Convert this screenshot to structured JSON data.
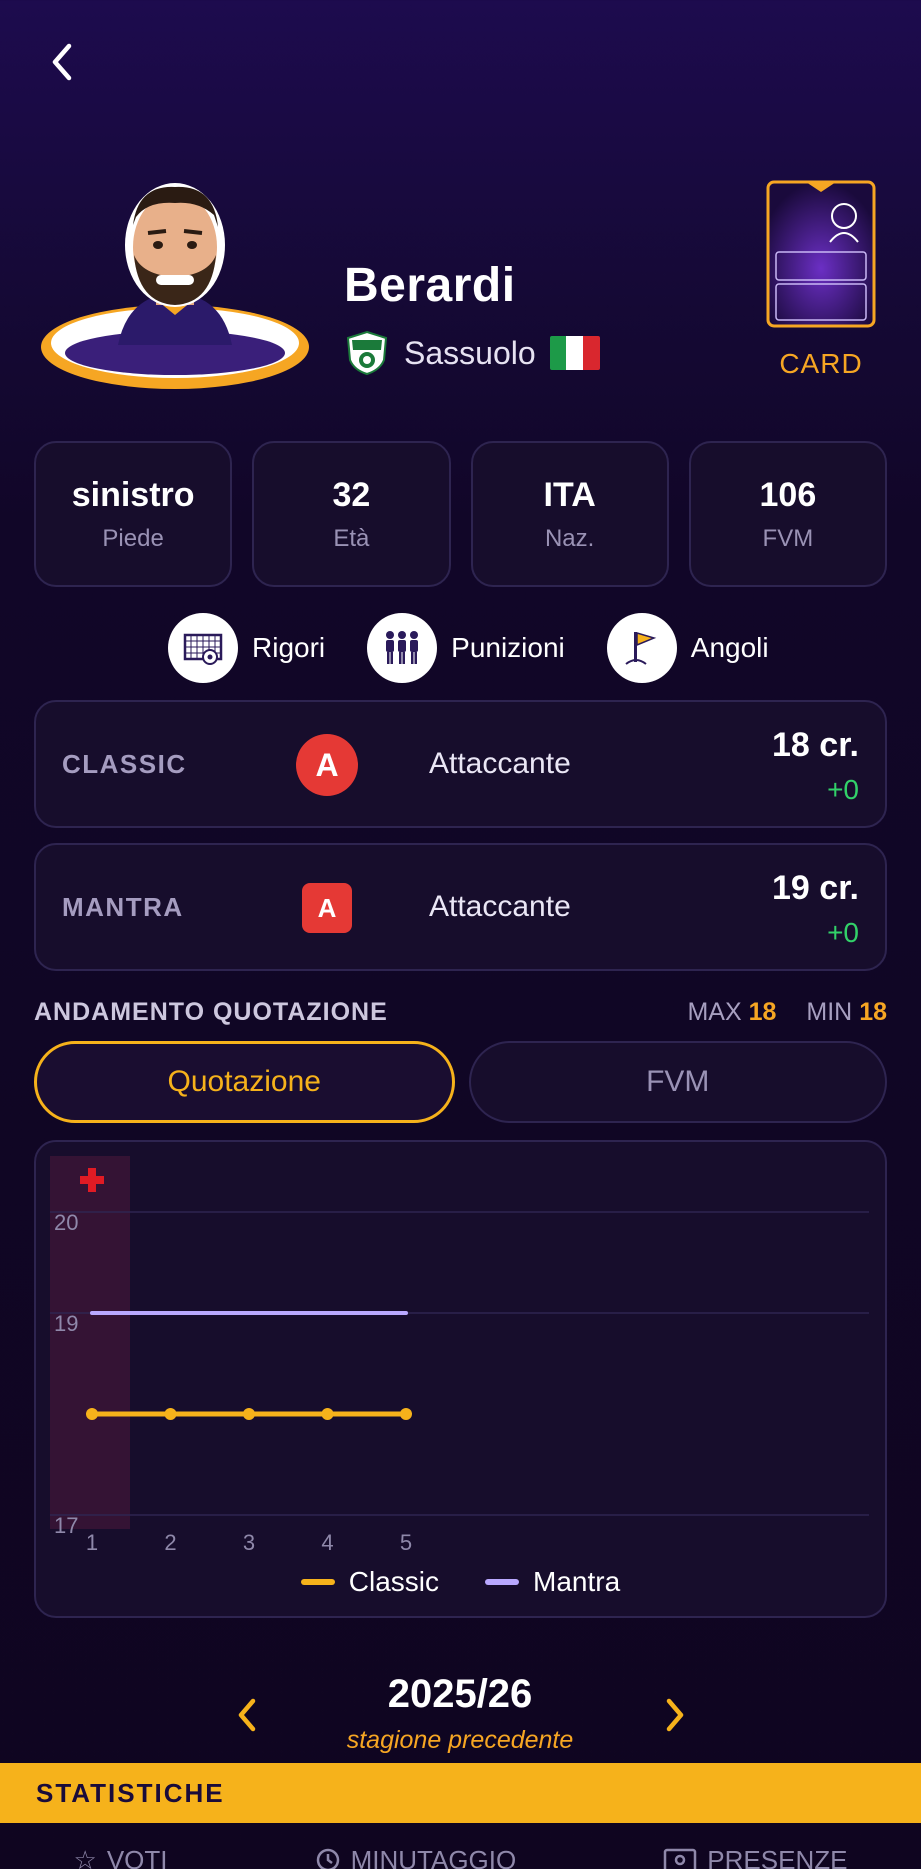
{
  "player": {
    "name": "Berardi",
    "team": "Sassuolo",
    "card_label": "CARD"
  },
  "tiles": [
    {
      "value": "sinistro",
      "label": "Piede"
    },
    {
      "value": "32",
      "label": "Età"
    },
    {
      "value": "ITA",
      "label": "Naz."
    },
    {
      "value": "106",
      "label": "FVM"
    }
  ],
  "skills": [
    {
      "label": "Rigori",
      "icon": "penalty-goal-icon"
    },
    {
      "label": "Punizioni",
      "icon": "wall-players-icon"
    },
    {
      "label": "Angoli",
      "icon": "corner-flag-icon"
    }
  ],
  "roles": [
    {
      "mode": "CLASSIC",
      "badge": "A",
      "role": "Attaccante",
      "price": "18 cr.",
      "delta": "+0"
    },
    {
      "mode": "MANTRA",
      "badge": "A",
      "role": "Attaccante",
      "price": "19 cr.",
      "delta": "+0"
    }
  ],
  "trend": {
    "title": "ANDAMENTO QUOTAZIONE",
    "max_label": "MAX",
    "max_value": "18",
    "min_label": "MIN",
    "min_value": "18",
    "tabs": [
      "Quotazione",
      "FVM"
    ]
  },
  "chart_data": {
    "type": "line",
    "x": [
      1,
      2,
      3,
      4,
      5
    ],
    "series": [
      {
        "name": "Classic",
        "values": [
          18,
          18,
          18,
          18,
          18
        ],
        "color": "#f6b21b"
      },
      {
        "name": "Mantra",
        "values": [
          19,
          19,
          19,
          19,
          19
        ],
        "color": "#b9a8ff"
      }
    ],
    "ylim": [
      17,
      20
    ],
    "yticks": [
      "20",
      "19",
      "17"
    ],
    "xticks": [
      "1",
      "2",
      "3",
      "4",
      "5"
    ],
    "highlight_x": 1,
    "highlight_marker": "injury-cross-icon"
  },
  "season": {
    "label": "2025/26",
    "sub": "stagione precedente"
  },
  "stats": {
    "title": "STATISTICHE",
    "tabs": [
      "VOTI",
      "MINUTAGGIO",
      "PRESENZE"
    ]
  }
}
